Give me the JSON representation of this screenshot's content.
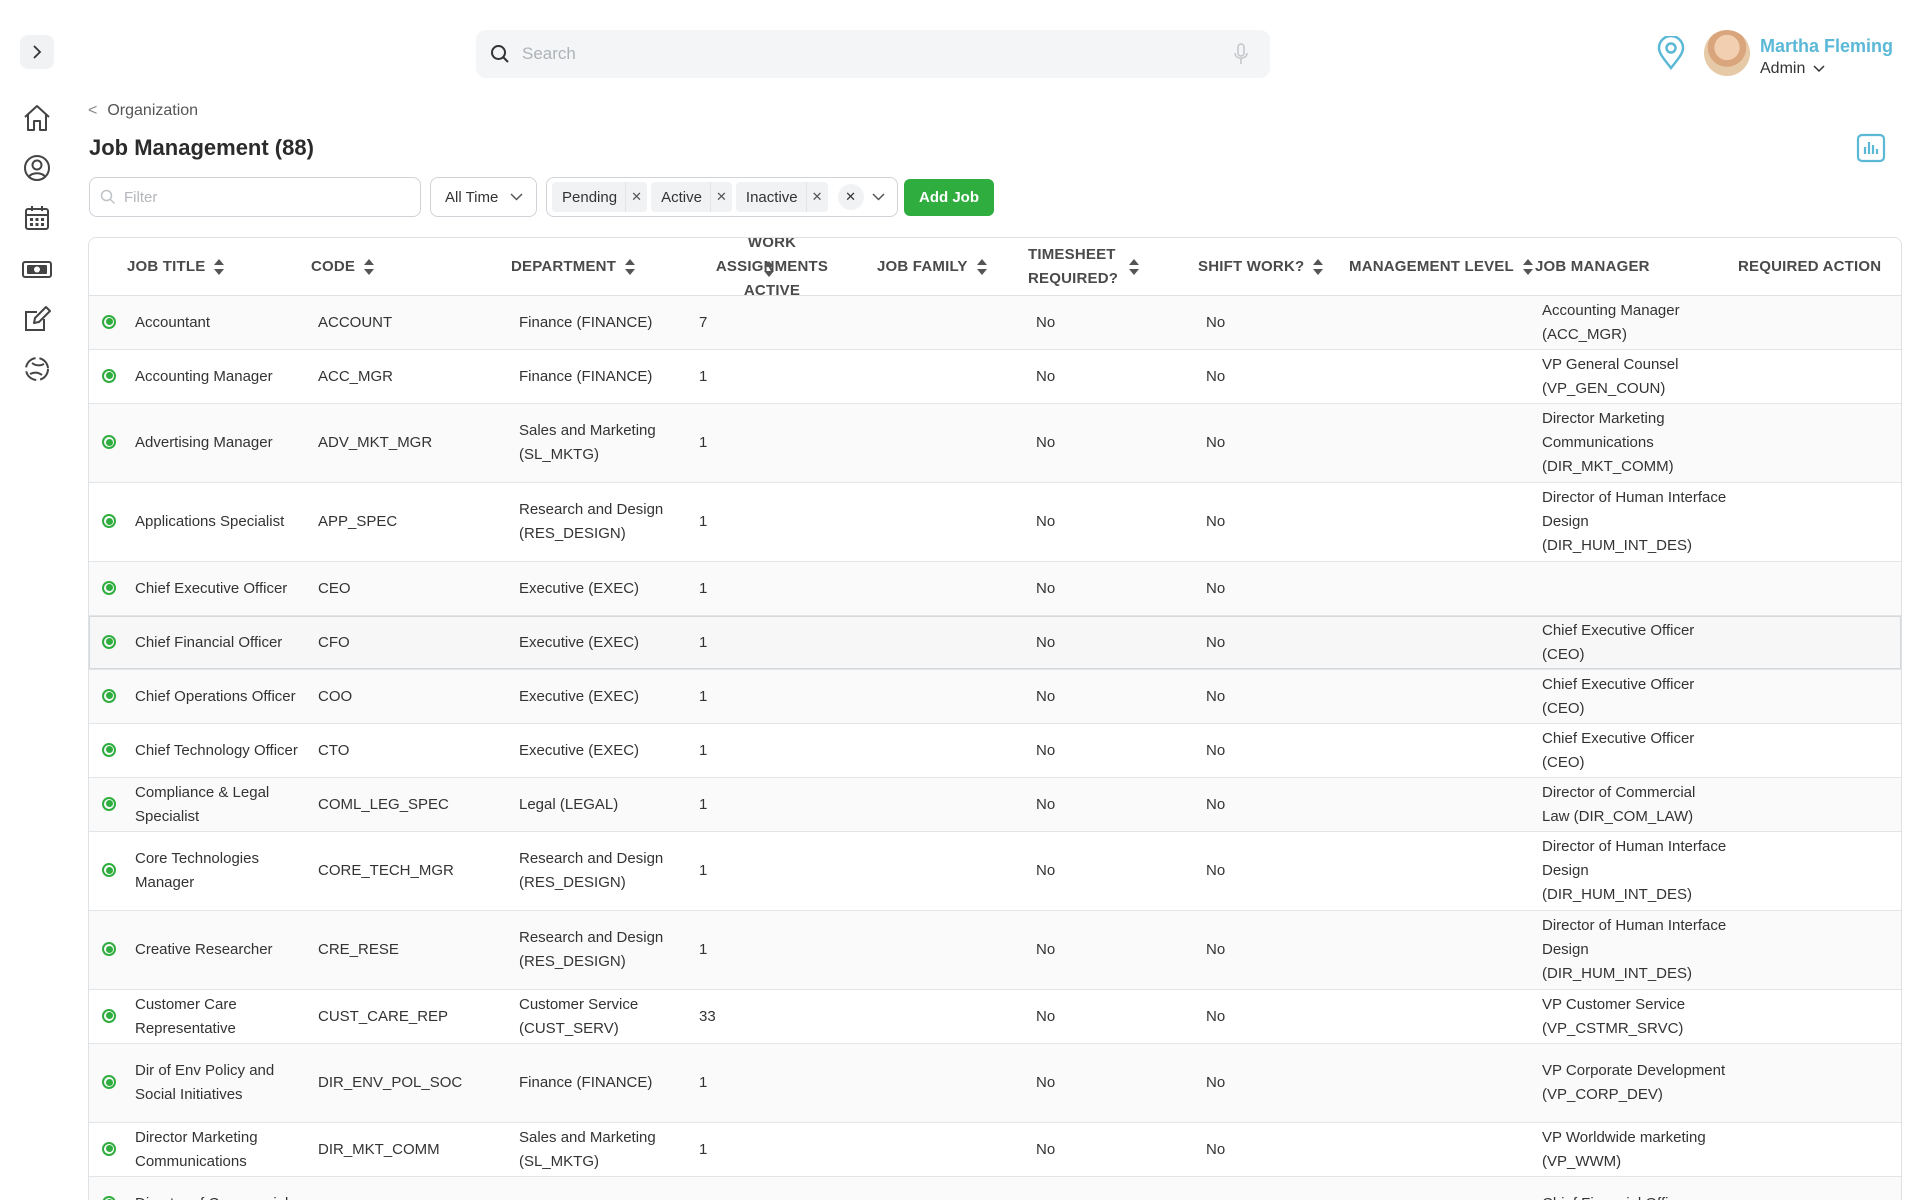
{
  "header": {
    "search_placeholder": "Search",
    "user_name": "Martha Fleming",
    "user_role": "Admin"
  },
  "breadcrumb": {
    "parent": "Organization"
  },
  "page": {
    "title": "Job Management (88)"
  },
  "toolbar": {
    "filter_placeholder": "Filter",
    "time_range": "All Time",
    "status_chips": [
      "Pending",
      "Active",
      "Inactive"
    ],
    "add_button": "Add Job"
  },
  "table": {
    "columns": [
      "JOB TITLE",
      "CODE",
      "DEPARTMENT",
      "WORK ASSIGNMENTS\nACTIVE",
      "JOB FAMILY",
      "TIMESHEET\nREQUIRED?",
      "SHIFT WORK?",
      "MANAGEMENT LEVEL",
      "JOB MANAGER",
      "REQUIRED ACTION"
    ],
    "rows": [
      {
        "title": "Accountant",
        "code": "ACCOUNT",
        "dept": "Finance (FINANCE)",
        "work": "7",
        "ts": "No",
        "shift": "No",
        "mgr": "Accounting Manager (ACC_MGR)"
      },
      {
        "title": "Accounting Manager",
        "code": "ACC_MGR",
        "dept": "Finance (FINANCE)",
        "work": "1",
        "ts": "No",
        "shift": "No",
        "mgr": "VP General Counsel (VP_GEN_COUN)"
      },
      {
        "title": "Advertising Manager",
        "code": "ADV_MKT_MGR",
        "dept": "Sales and Marketing (SL_MKTG)",
        "work": "1",
        "ts": "No",
        "shift": "No",
        "mgr": "Director Marketing Communications (DIR_MKT_COMM)"
      },
      {
        "title": "Applications Specialist",
        "code": "APP_SPEC",
        "dept": "Research and Design (RES_DESIGN)",
        "work": "1",
        "ts": "No",
        "shift": "No",
        "mgr": "Director of Human Interface Design (DIR_HUM_INT_DES)"
      },
      {
        "title": "Chief Executive Officer",
        "code": "CEO",
        "dept": "Executive (EXEC)",
        "work": "1",
        "ts": "No",
        "shift": "No",
        "mgr": ""
      },
      {
        "title": "Chief Financial Officer",
        "code": "CFO",
        "dept": "Executive (EXEC)",
        "work": "1",
        "ts": "No",
        "shift": "No",
        "mgr": "Chief Executive Officer (CEO)"
      },
      {
        "title": "Chief Operations Officer",
        "code": "COO",
        "dept": "Executive (EXEC)",
        "work": "1",
        "ts": "No",
        "shift": "No",
        "mgr": "Chief Executive Officer (CEO)"
      },
      {
        "title": "Chief Technology Officer",
        "code": "CTO",
        "dept": "Executive (EXEC)",
        "work": "1",
        "ts": "No",
        "shift": "No",
        "mgr": "Chief Executive Officer (CEO)"
      },
      {
        "title": "Compliance & Legal Specialist",
        "code": "COML_LEG_SPEC",
        "dept": "Legal (LEGAL)",
        "work": "1",
        "ts": "No",
        "shift": "No",
        "mgr": "Director of Commercial Law (DIR_COM_LAW)"
      },
      {
        "title": "Core Technologies Manager",
        "code": "CORE_TECH_MGR",
        "dept": "Research and Design (RES_DESIGN)",
        "work": "1",
        "ts": "No",
        "shift": "No",
        "mgr": "Director of Human Interface Design (DIR_HUM_INT_DES)"
      },
      {
        "title": "Creative Researcher",
        "code": "CRE_RESE",
        "dept": "Research and Design (RES_DESIGN)",
        "work": "1",
        "ts": "No",
        "shift": "No",
        "mgr": "Director of Human Interface Design (DIR_HUM_INT_DES)"
      },
      {
        "title": "Customer Care Representative",
        "code": "CUST_CARE_REP",
        "dept": "Customer Service (CUST_SERV)",
        "work": "33",
        "ts": "No",
        "shift": "No",
        "mgr": "VP Customer Service (VP_CSTMR_SRVC)"
      },
      {
        "title": "Dir of Env Policy and Social Initiatives",
        "code": "DIR_ENV_POL_SOC",
        "dept": "Finance (FINANCE)",
        "work": "1",
        "ts": "No",
        "shift": "No",
        "mgr": "VP Corporate Development (VP_CORP_DEV)"
      },
      {
        "title": "Director Marketing Communications",
        "code": "DIR_MKT_COMM",
        "dept": "Sales and Marketing (SL_MKTG)",
        "work": "1",
        "ts": "No",
        "shift": "No",
        "mgr": "VP Worldwide marketing (VP_WWM)"
      },
      {
        "title": "Director of Commercial",
        "code": "",
        "dept": "",
        "work": "",
        "ts": "",
        "shift": "",
        "mgr": "Chief Financial Officer"
      }
    ]
  }
}
